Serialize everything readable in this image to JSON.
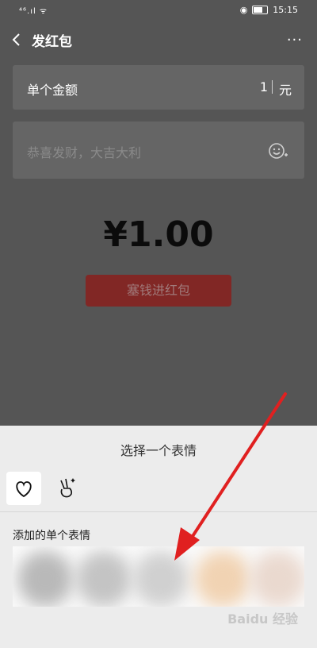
{
  "status": {
    "left": "⁴⁶.ıl ᯤ",
    "time": "15:15"
  },
  "header": {
    "title": "发红包",
    "more": "···"
  },
  "amount": {
    "label": "单个金额",
    "value": "1",
    "unit": "元"
  },
  "greeting": {
    "placeholder": "恭喜发财，大吉大利"
  },
  "total": "¥1.00",
  "send_button": "塞钱进红包",
  "sheet": {
    "title": "选择一个表情",
    "added_label": "添加的单个表情"
  },
  "watermark": "Baidu 经验",
  "colors": {
    "accent_red": "#812725",
    "annotation_arrow": "#e02020",
    "dim": "#555555",
    "sheet": "#ececec"
  }
}
